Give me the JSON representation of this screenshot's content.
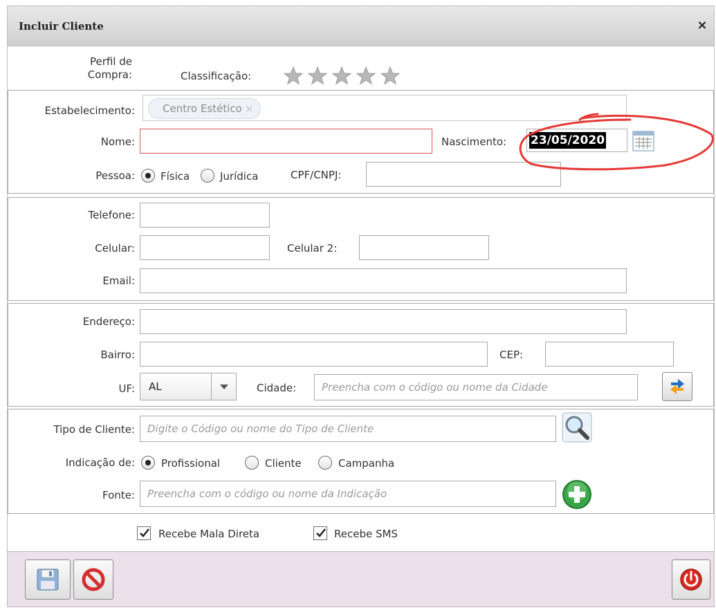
{
  "window": {
    "title": "Incluir Cliente",
    "close_label": "×"
  },
  "header": {
    "perfil_label_line1": "Perfil de",
    "perfil_label_line2": "Compra:",
    "classificacao_label": "Classificação:",
    "rating": {
      "value": 0,
      "max": 5,
      "star_color": "#b5b5b5"
    }
  },
  "section_main": {
    "estabelecimento_label": "Estabelecimento:",
    "estabelecimento_tag": "Centro Estético",
    "tag_remove": "×",
    "nome_label": "Nome:",
    "nome_value": "",
    "nascimento_label": "Nascimento:",
    "nascimento_value": "23/05/2020",
    "pessoa_label": "Pessoa:",
    "pessoa_options": [
      "Física",
      "Jurídica"
    ],
    "pessoa_selected": "Física",
    "cpf_label": "CPF/CNPJ:",
    "cpf_value": ""
  },
  "section_contact": {
    "telefone_label": "Telefone:",
    "celular_label": "Celular:",
    "celular2_label": "Celular 2:",
    "email_label": "Email:"
  },
  "section_address": {
    "endereco_label": "Endereço:",
    "bairro_label": "Bairro:",
    "cep_label": "CEP:",
    "uf_label": "UF:",
    "uf_value": "AL",
    "cidade_label": "Cidade:",
    "cidade_placeholder": "Preencha com o código ou nome da Cidade"
  },
  "section_type": {
    "tipo_label": "Tipo de Cliente:",
    "tipo_placeholder": "Digite o Código ou nome do Tipo de Cliente",
    "indicacao_label": "Indicação de:",
    "indicacao_options": [
      "Profissional",
      "Cliente",
      "Campanha"
    ],
    "indicacao_selected": "Profissional",
    "fonte_label": "Fonte:",
    "fonte_placeholder": "Preencha com o código ou nome da Indicação"
  },
  "options": {
    "mala_direta_label": "Recebe Mala Direta",
    "mala_direta_checked": true,
    "sms_label": "Recebe SMS",
    "sms_checked": true
  },
  "colors": {
    "annotation": "#e53935",
    "footer_bg": "#ece0ea",
    "error_border": "#d9534f",
    "cancel_red": "#d32f2f"
  }
}
